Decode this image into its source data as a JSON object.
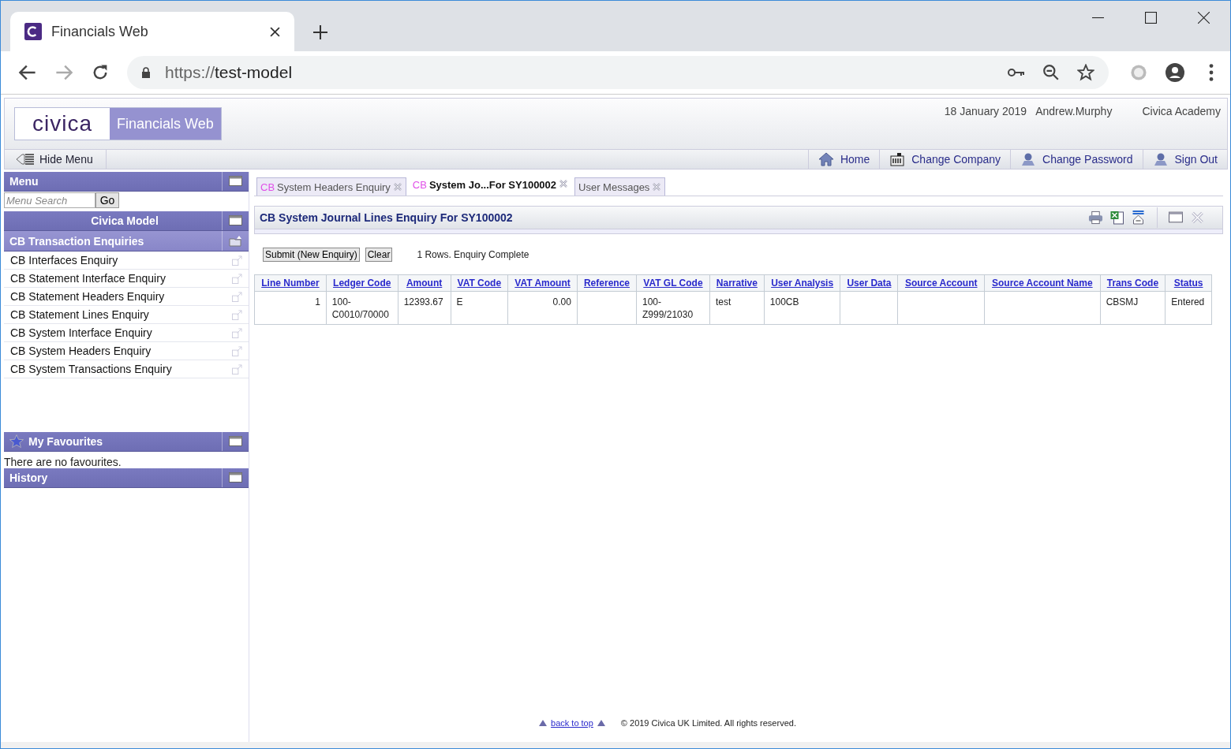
{
  "browser": {
    "tab_title": "Financials Web",
    "url_scheme": "https://",
    "url_host": "test-model"
  },
  "header": {
    "logo": "civica",
    "product": "Financials Web",
    "date": "18 January 2019",
    "user": "Andrew.Murphy",
    "company": "Civica Academy"
  },
  "nav": {
    "hide_menu": "Hide Menu",
    "links": [
      {
        "label": "Home",
        "kind": "home"
      },
      {
        "label": "Change Company",
        "kind": "company"
      },
      {
        "label": "Change Password",
        "kind": "user"
      },
      {
        "label": "Sign Out",
        "kind": "user"
      }
    ]
  },
  "sidebar": {
    "menu_title": "Menu",
    "search": {
      "placeholder": "Menu Search",
      "button": "Go"
    },
    "model_title": "Civica Model",
    "section_title": "CB Transaction Enquiries",
    "items": [
      "CB Interfaces Enquiry",
      "CB Statement Interface Enquiry",
      "CB Statement Headers Enquiry",
      "CB Statement Lines Enquiry",
      "CB System Interface Enquiry",
      "CB System Headers Enquiry",
      "CB System Transactions Enquiry"
    ],
    "favourites_title": "My Favourites",
    "favourites_empty": "There are no favourites.",
    "history_title": "History"
  },
  "tabs": [
    {
      "prefix": "CB",
      "label": "System Headers Enquiry",
      "selected": false
    },
    {
      "prefix": "CB",
      "label": "System Jo...For SY100002",
      "selected": true
    },
    {
      "label": "User Messages",
      "selected": false
    }
  ],
  "panel": {
    "title": "CB System Journal Lines Enquiry For SY100002",
    "buttons": [
      "Submit (New Enquiry)",
      "Clear"
    ],
    "status": "1 Rows. Enquiry Complete"
  },
  "table": {
    "columns": [
      {
        "label": "Line Number",
        "kind": "number"
      },
      {
        "label": "Ledger Code",
        "kind": "text"
      },
      {
        "label": "Amount",
        "kind": "text"
      },
      {
        "label": "VAT Code",
        "kind": "text"
      },
      {
        "label": "VAT Amount",
        "kind": "number"
      },
      {
        "label": "Reference",
        "kind": "text"
      },
      {
        "label": "VAT GL Code",
        "kind": "text"
      },
      {
        "label": "Narrative",
        "kind": "text"
      },
      {
        "label": "User Analysis",
        "kind": "text"
      },
      {
        "label": "User Data",
        "kind": "text"
      },
      {
        "label": "Source Account",
        "kind": "text"
      },
      {
        "label": "Source Account Name",
        "kind": "text"
      },
      {
        "label": "Trans Code",
        "kind": "text"
      },
      {
        "label": "Status",
        "kind": "text"
      }
    ],
    "rows": [
      [
        "1",
        "100-\nC0010/70000",
        "12393.67",
        "E",
        "0.00",
        "",
        "100-\nZ999/21030",
        "test",
        "100CB",
        "",
        "",
        "",
        "CBSMJ",
        "Entered"
      ]
    ]
  },
  "footer": {
    "back_to_top": "back to top",
    "copyright": "© 2019 Civica UK Limited. All rights reserved."
  }
}
